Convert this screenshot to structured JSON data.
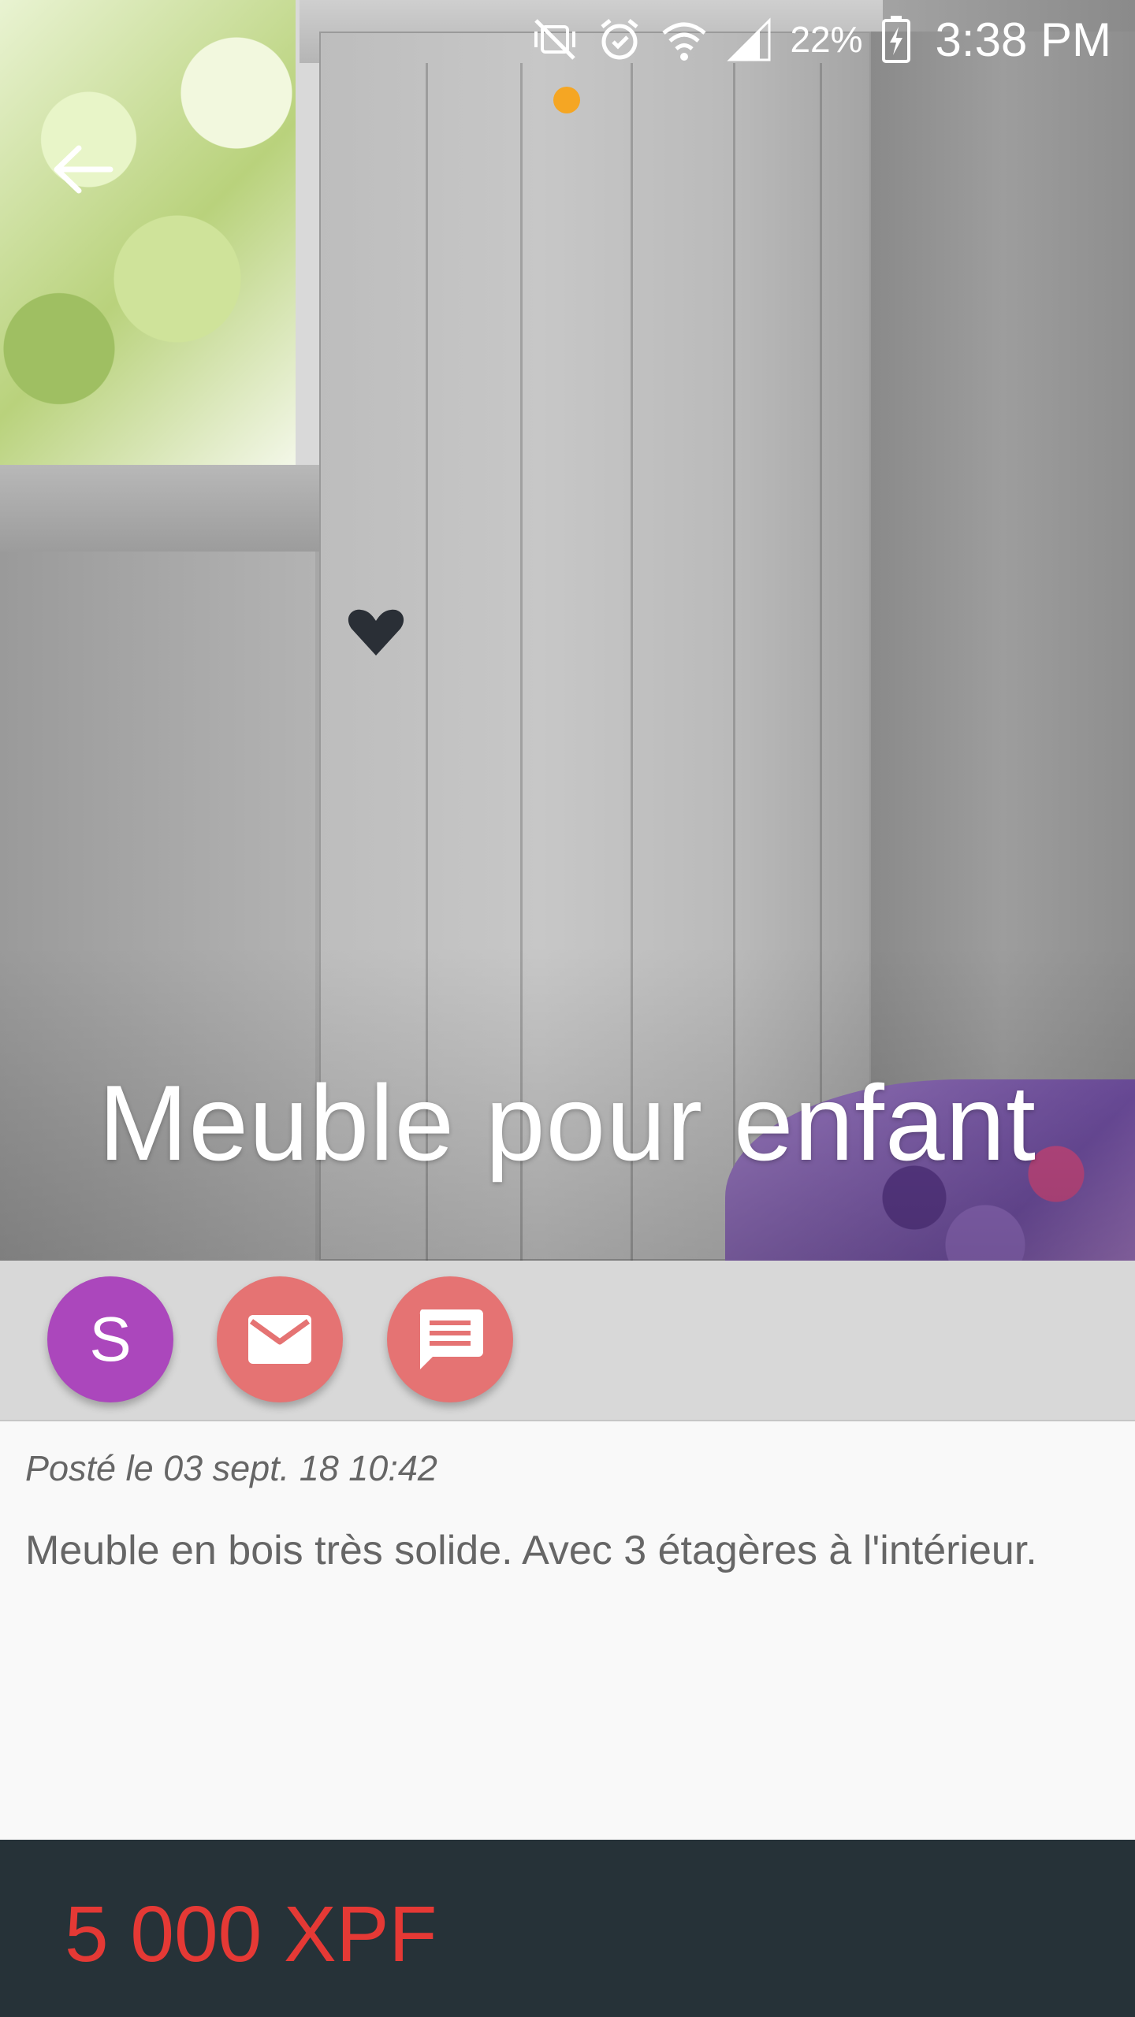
{
  "status_bar": {
    "battery_percent": "22%",
    "time": "3:38 PM",
    "icons": [
      "mute-vibrate-icon",
      "alarm-icon",
      "wifi-icon",
      "signal-icon",
      "battery-charging-icon"
    ]
  },
  "listing": {
    "title": "Meuble pour enfant",
    "seller_initial": "S",
    "posted": "Posté le 03 sept. 18 10:42",
    "description": "Meuble en bois très solide. Avec 3 étagères à l'intérieur.",
    "price": "5 000 XPF"
  },
  "colors": {
    "avatar": "#ab47bc",
    "action_buttons": "#e57373",
    "price_bar": "#263238",
    "price_text": "#e53935",
    "page_indicator": "#f5a623"
  }
}
